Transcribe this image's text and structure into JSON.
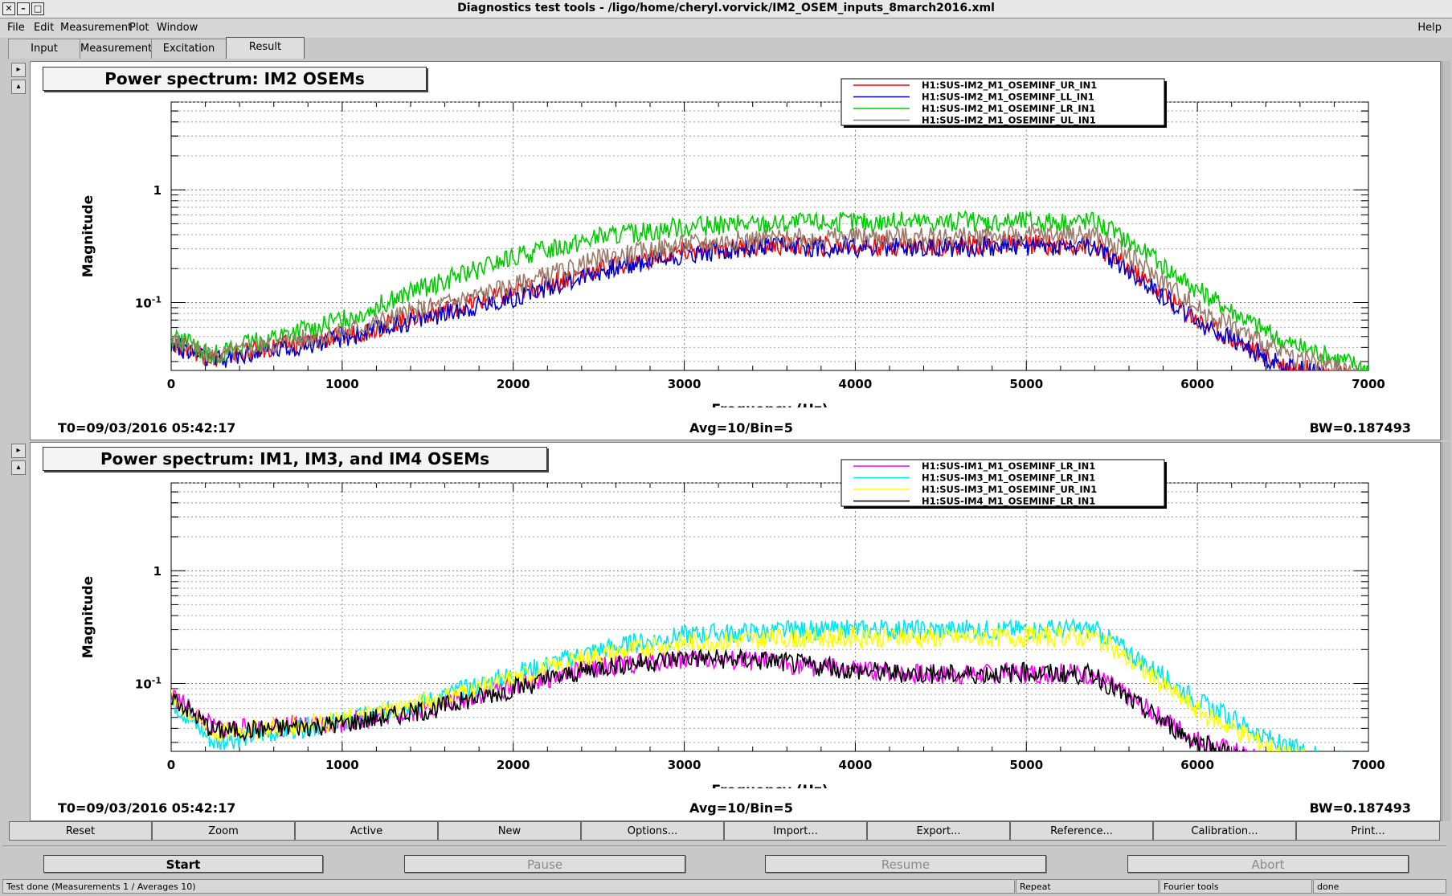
{
  "window": {
    "title": "Diagnostics test tools - /ligo/home/cheryl.vorvick/IM2_OSEM_inputs_8march2016.xml",
    "controls": [
      "✕",
      "–",
      "□"
    ]
  },
  "menubar": {
    "items": [
      "File",
      "Edit",
      "Measurement",
      "Plot",
      "Window"
    ],
    "help": "Help"
  },
  "tabs": [
    "Input",
    "Measurement",
    "Excitation",
    "Result"
  ],
  "panel_buttons": {
    "expand": "▸",
    "collapse": "▴"
  },
  "plots": [
    {
      "title": "Power spectrum: IM2 OSEMs",
      "t0": "T0=09/03/2016 05:42:17",
      "avg": "Avg=10/Bin=5",
      "bw": "BW=0.187493"
    },
    {
      "title": "Power spectrum: IM1, IM3, and IM4 OSEMs",
      "t0": "T0=09/03/2016 05:42:17",
      "avg": "Avg=10/Bin=5",
      "bw": "BW=0.187493"
    }
  ],
  "chart_data": [
    {
      "type": "line",
      "title": "Power spectrum: IM2 OSEMs",
      "xlabel": "Frequency (Hz)",
      "ylabel": "Magnitude",
      "xlim": [
        0,
        7000
      ],
      "ylim": [
        0.025,
        6
      ],
      "yscale": "log",
      "grid": true,
      "legend_position": "top-right",
      "x_ticks": [
        "0",
        "1000",
        "2000",
        "3000",
        "4000",
        "5000",
        "6000",
        "7000"
      ],
      "y_ticks": [
        {
          "label": "1",
          "value": 1
        },
        {
          "label": "10",
          "sup": "-1",
          "value": 0.1
        }
      ],
      "series": [
        {
          "name": "H1:SUS-IM2_M1_OSEMINF_UR_IN1",
          "color": "#ff0000",
          "x": [
            0,
            250,
            500,
            1000,
            1500,
            2000,
            2500,
            3000,
            3500,
            4000,
            4500,
            5000,
            5400,
            5600,
            6000,
            6500,
            7000
          ],
          "values": [
            0.045,
            0.032,
            0.038,
            0.05,
            0.08,
            0.12,
            0.2,
            0.28,
            0.32,
            0.32,
            0.32,
            0.33,
            0.32,
            0.2,
            0.07,
            0.028,
            0.02
          ]
        },
        {
          "name": "H1:SUS-IM2_M1_OSEMINF_LL_IN1",
          "color": "#0000cc",
          "x": [
            0,
            250,
            500,
            1000,
            1500,
            2000,
            2500,
            3000,
            3500,
            4000,
            4500,
            5000,
            5400,
            5600,
            6000,
            6500,
            7000
          ],
          "values": [
            0.043,
            0.03,
            0.036,
            0.048,
            0.075,
            0.11,
            0.19,
            0.27,
            0.31,
            0.31,
            0.31,
            0.32,
            0.31,
            0.19,
            0.068,
            0.027,
            0.019
          ]
        },
        {
          "name": "H1:SUS-IM2_M1_OSEMINF_LR_IN1",
          "color": "#00cc00",
          "x": [
            0,
            250,
            500,
            1000,
            1500,
            2000,
            2500,
            3000,
            3500,
            4000,
            4500,
            5000,
            5400,
            5600,
            6000,
            6500,
            7000
          ],
          "values": [
            0.05,
            0.035,
            0.045,
            0.07,
            0.14,
            0.25,
            0.38,
            0.47,
            0.5,
            0.52,
            0.52,
            0.53,
            0.53,
            0.35,
            0.13,
            0.045,
            0.026
          ]
        },
        {
          "name": "H1:SUS-IM2_M1_OSEMINF_UL_IN1",
          "color": "#9a7a6a",
          "x": [
            0,
            250,
            500,
            1000,
            1500,
            2000,
            2500,
            3000,
            3500,
            4000,
            4500,
            5000,
            5400,
            5600,
            6000,
            6500,
            7000
          ],
          "values": [
            0.046,
            0.033,
            0.04,
            0.055,
            0.09,
            0.14,
            0.24,
            0.33,
            0.37,
            0.38,
            0.38,
            0.4,
            0.4,
            0.26,
            0.09,
            0.035,
            0.022
          ]
        }
      ]
    },
    {
      "type": "line",
      "title": "Power spectrum: IM1, IM3, and IM4 OSEMs",
      "xlabel": "Frequency (Hz)",
      "ylabel": "Magnitude",
      "xlim": [
        0,
        7000
      ],
      "ylim": [
        0.025,
        6
      ],
      "yscale": "log",
      "grid": true,
      "legend_position": "top-right",
      "x_ticks": [
        "0",
        "1000",
        "2000",
        "3000",
        "4000",
        "5000",
        "6000",
        "7000"
      ],
      "y_ticks": [
        {
          "label": "1",
          "value": 1
        },
        {
          "label": "10",
          "sup": "-1",
          "value": 0.1
        }
      ],
      "series": [
        {
          "name": "H1:SUS-IM1_M1_OSEMINF_LR_IN1",
          "color": "#ff00ff",
          "x": [
            0,
            250,
            500,
            1000,
            1500,
            2000,
            2500,
            3000,
            3500,
            4000,
            4500,
            5000,
            5400,
            5600,
            6000,
            6500,
            7000
          ],
          "values": [
            0.08,
            0.04,
            0.04,
            0.045,
            0.06,
            0.095,
            0.14,
            0.165,
            0.155,
            0.13,
            0.12,
            0.125,
            0.12,
            0.075,
            0.032,
            0.018,
            0.012
          ]
        },
        {
          "name": "H1:SUS-IM3_M1_OSEMINF_LR_IN1",
          "color": "#00e5ee",
          "x": [
            0,
            250,
            500,
            1000,
            1500,
            2000,
            2500,
            3000,
            3500,
            4000,
            4500,
            5000,
            5400,
            5600,
            6000,
            6500,
            7000
          ],
          "values": [
            0.07,
            0.03,
            0.035,
            0.045,
            0.07,
            0.12,
            0.2,
            0.27,
            0.29,
            0.3,
            0.3,
            0.3,
            0.3,
            0.19,
            0.07,
            0.028,
            0.018
          ]
        },
        {
          "name": "H1:SUS-IM3_M1_OSEMINF_UR_IN1",
          "color": "#ffff00",
          "x": [
            0,
            250,
            500,
            1000,
            1500,
            2000,
            2500,
            3000,
            3500,
            4000,
            4500,
            5000,
            5400,
            5600,
            6000,
            6500,
            7000
          ],
          "values": [
            0.075,
            0.036,
            0.04,
            0.047,
            0.07,
            0.11,
            0.18,
            0.23,
            0.25,
            0.255,
            0.255,
            0.26,
            0.26,
            0.16,
            0.058,
            0.024,
            0.016
          ]
        },
        {
          "name": "H1:SUS-IM4_M1_OSEMINF_LR_IN1",
          "color": "#000000",
          "x": [
            0,
            250,
            500,
            1000,
            1500,
            2000,
            2500,
            3000,
            3500,
            4000,
            4500,
            5000,
            5400,
            5600,
            6000,
            6500,
            7000
          ],
          "values": [
            0.078,
            0.038,
            0.039,
            0.044,
            0.058,
            0.09,
            0.14,
            0.17,
            0.16,
            0.13,
            0.12,
            0.125,
            0.12,
            0.072,
            0.03,
            0.017,
            0.011
          ]
        }
      ]
    }
  ],
  "toolbar": [
    "Reset",
    "Zoom",
    "Active",
    "New",
    "Options...",
    "Import...",
    "Export...",
    "Reference...",
    "Calibration...",
    "Print..."
  ],
  "controls": {
    "start": "Start",
    "pause": "Pause",
    "resume": "Resume",
    "abort": "Abort"
  },
  "statusbar": {
    "message": "Test done (Measurements 1 / Averages 10)",
    "mode": "Repeat",
    "tool": "Fourier tools",
    "state": "done"
  }
}
